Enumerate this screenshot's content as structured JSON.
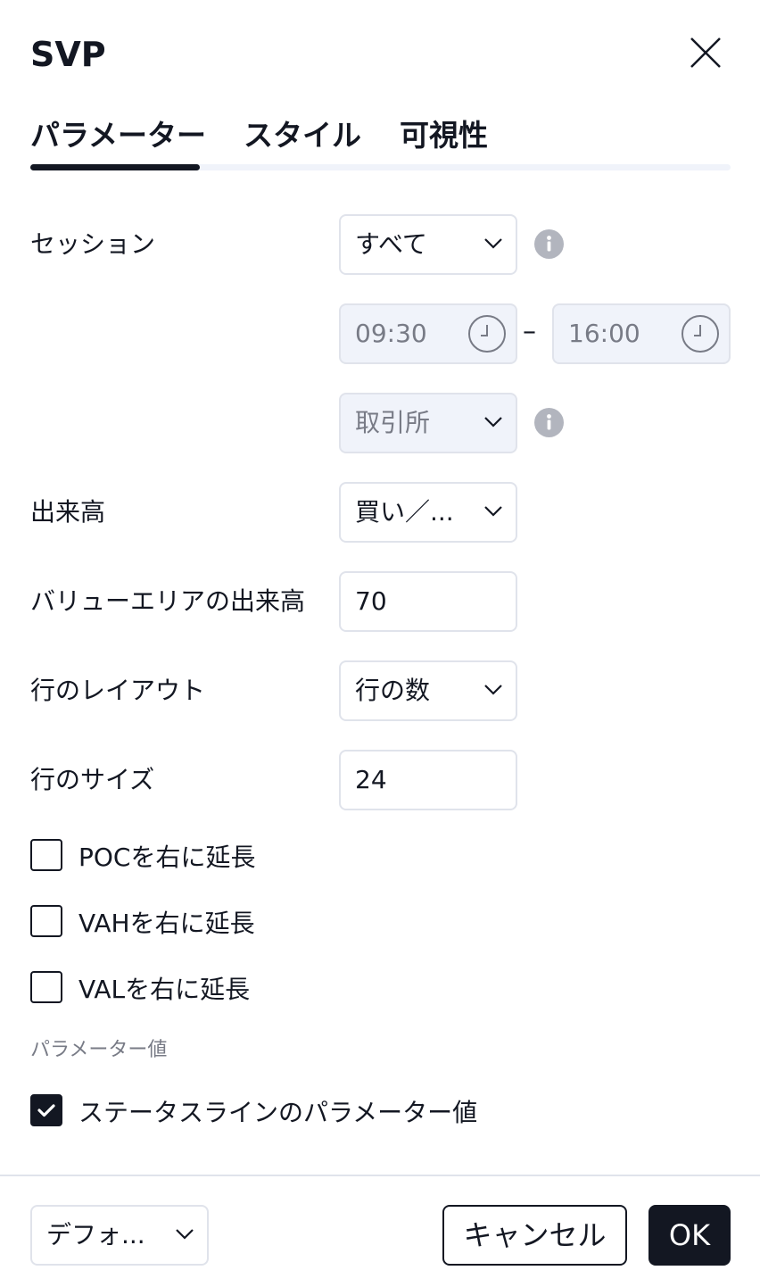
{
  "dialog": {
    "title": "SVP",
    "close_icon": "close-icon"
  },
  "tabs": [
    {
      "label": "パラメーター",
      "active": true
    },
    {
      "label": "スタイル",
      "active": false
    },
    {
      "label": "可視性",
      "active": false
    }
  ],
  "params": {
    "session": {
      "label": "セッション",
      "value": "すべて",
      "info_icon": "info-icon"
    },
    "session_time": {
      "start": "09:30",
      "end": "16:00",
      "separator": "–"
    },
    "exchange": {
      "value": "取引所",
      "info_icon": "info-icon"
    },
    "volume": {
      "label": "出来高",
      "value": "買い／..."
    },
    "value_area_volume": {
      "label": "バリューエリアの出来高",
      "value": "70"
    },
    "row_layout": {
      "label": "行のレイアウト",
      "value": "行の数"
    },
    "row_size": {
      "label": "行のサイズ",
      "value": "24"
    },
    "extend_poc": {
      "label": "POCを右に延長",
      "checked": false
    },
    "extend_vah": {
      "label": "VAHを右に延長",
      "checked": false
    },
    "extend_val": {
      "label": "VALを右に延長",
      "checked": false
    }
  },
  "param_values_section": {
    "header": "パラメーター値",
    "status_line": {
      "label": "ステータスラインのパラメーター値",
      "checked": true
    }
  },
  "footer": {
    "defaults_value": "デフォ...",
    "cancel_label": "キャンセル",
    "ok_label": "OK"
  },
  "colors": {
    "text": "#131722",
    "border": "#e0e3eb",
    "disabled_bg": "#f0f3fa",
    "muted": "#787b86",
    "info_icon": "#b2b5be"
  }
}
